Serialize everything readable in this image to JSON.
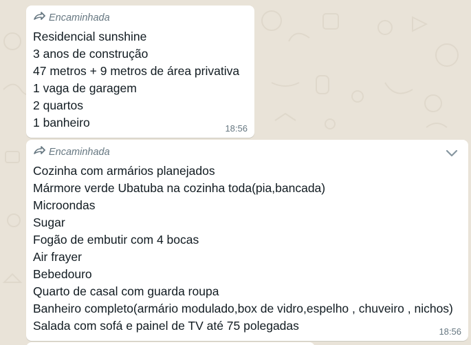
{
  "messages": [
    {
      "forwarded_label": "Encaminhada",
      "lines": [
        "Residencial sunshine",
        "3 anos de construção",
        "47 metros + 9 metros de área privativa",
        "1 vaga de garagem",
        "2 quartos",
        "1 banheiro"
      ],
      "time": "18:56"
    },
    {
      "forwarded_label": "Encaminhada",
      "lines": [
        "Cozinha com armários planejados",
        "Mármore verde Ubatuba na cozinha toda(pia,bancada)",
        "Microondas",
        "Sugar",
        "Fogão de embutir com 4 bocas",
        "Air frayer",
        "Bebedouro",
        "Quarto de casal com guarda roupa",
        "Banheiro completo(armário modulado,box de vidro,espelho , chuveiro , nichos)",
        "Salada com sofá e painel de TV até 75 polegadas"
      ],
      "time": "18:56"
    }
  ],
  "icons": {
    "forwarded": "forwarded-icon",
    "menu": "chevron-down-icon"
  },
  "colors": {
    "chat_background": "#e9e3d8",
    "bubble": "#ffffff",
    "text": "#111b21",
    "meta": "#667781"
  }
}
